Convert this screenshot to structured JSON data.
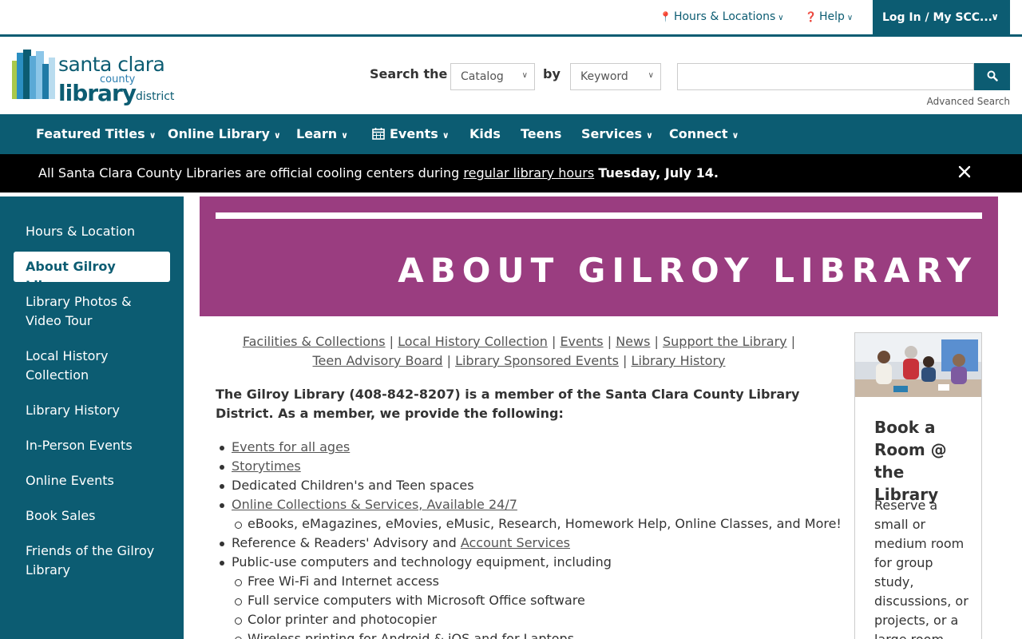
{
  "utility": {
    "hours": "Hours & Locations",
    "help": "Help",
    "login": "Log In / My SCC..."
  },
  "logo": {
    "line1": "santa clara",
    "line2": "county",
    "line3": "library",
    "line4": "district"
  },
  "search": {
    "label": "Search the",
    "scope": "Catalog",
    "by": "by",
    "field": "Keyword",
    "query": "",
    "advanced": "Advanced Search"
  },
  "nav": {
    "items": [
      "Featured Titles",
      "Online Library",
      "Learn",
      "Events",
      "Kids",
      "Teens",
      "Services",
      "Connect"
    ]
  },
  "alert": {
    "before": "All Santa Clara County Libraries are official cooling centers during ",
    "link": "regular library hours",
    "bold": "Tuesday, July 14."
  },
  "sidebar": {
    "items": [
      "Hours & Location",
      "About Gilroy Library",
      "Library Photos & Video Tour",
      "Local History Collection",
      "Library History",
      "In-Person Events",
      "Online Events",
      "Book Sales",
      "Friends of the Gilroy Library"
    ]
  },
  "banner": {
    "title": "ABOUT GILROY LIBRARY"
  },
  "subnav": {
    "links": [
      "Facilities & Collections",
      "Local History Collection",
      "Events",
      "News",
      "Support the Library",
      "Teen Advisory Board",
      "Library Sponsored Events",
      "Library History"
    ],
    "separator": "|"
  },
  "intro": "The Gilroy Library (408-842-8207) is a member of the Santa Clara County Library District. As a member, we provide the following:",
  "list": {
    "events": "Events for all ages",
    "storytimes": "Storytimes",
    "spaces": "Dedicated Children's and Teen spaces",
    "online": "Online Collections & Services, Available 24/7",
    "online_sub": "eBooks, eMagazines, eMovies, eMusic, Research, Homework Help, Online Classes, and More!",
    "reference_prefix": "Reference & Readers' Advisory and ",
    "account": "Account Services",
    "computers": "Public-use computers and technology equipment, including",
    "wifi": "Free Wi-Fi and Internet access",
    "office": "Full service computers with Microsoft Office software",
    "printer": "Color printer and photocopier",
    "wireless": "Wireless printing for Android & iOS and for Laptops"
  },
  "promo": {
    "title": "Book a Room @ the Library",
    "text": "Reserve a small or medium room for group study, discussions, or projects, or a large room"
  },
  "colors": {
    "teal": "#0c5c72",
    "magenta": "#9a3d80",
    "alert_bg": "#000000"
  }
}
